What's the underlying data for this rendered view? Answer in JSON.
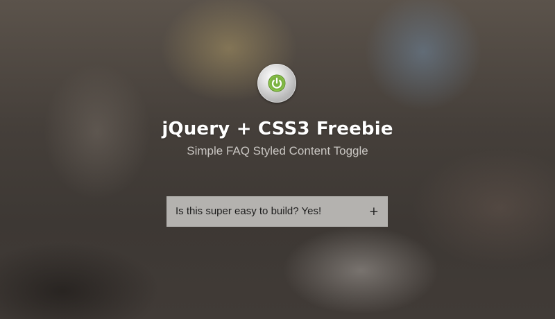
{
  "header": {
    "logo_icon": "power-button-icon",
    "accent_color": "#7cb342",
    "title": "jQuery + CSS3 Freebie",
    "subtitle": "Simple FAQ Styled Content Toggle"
  },
  "faq": {
    "items": [
      {
        "question": "Is this super easy to build? Yes!",
        "toggle": "+",
        "expanded": false
      }
    ]
  }
}
